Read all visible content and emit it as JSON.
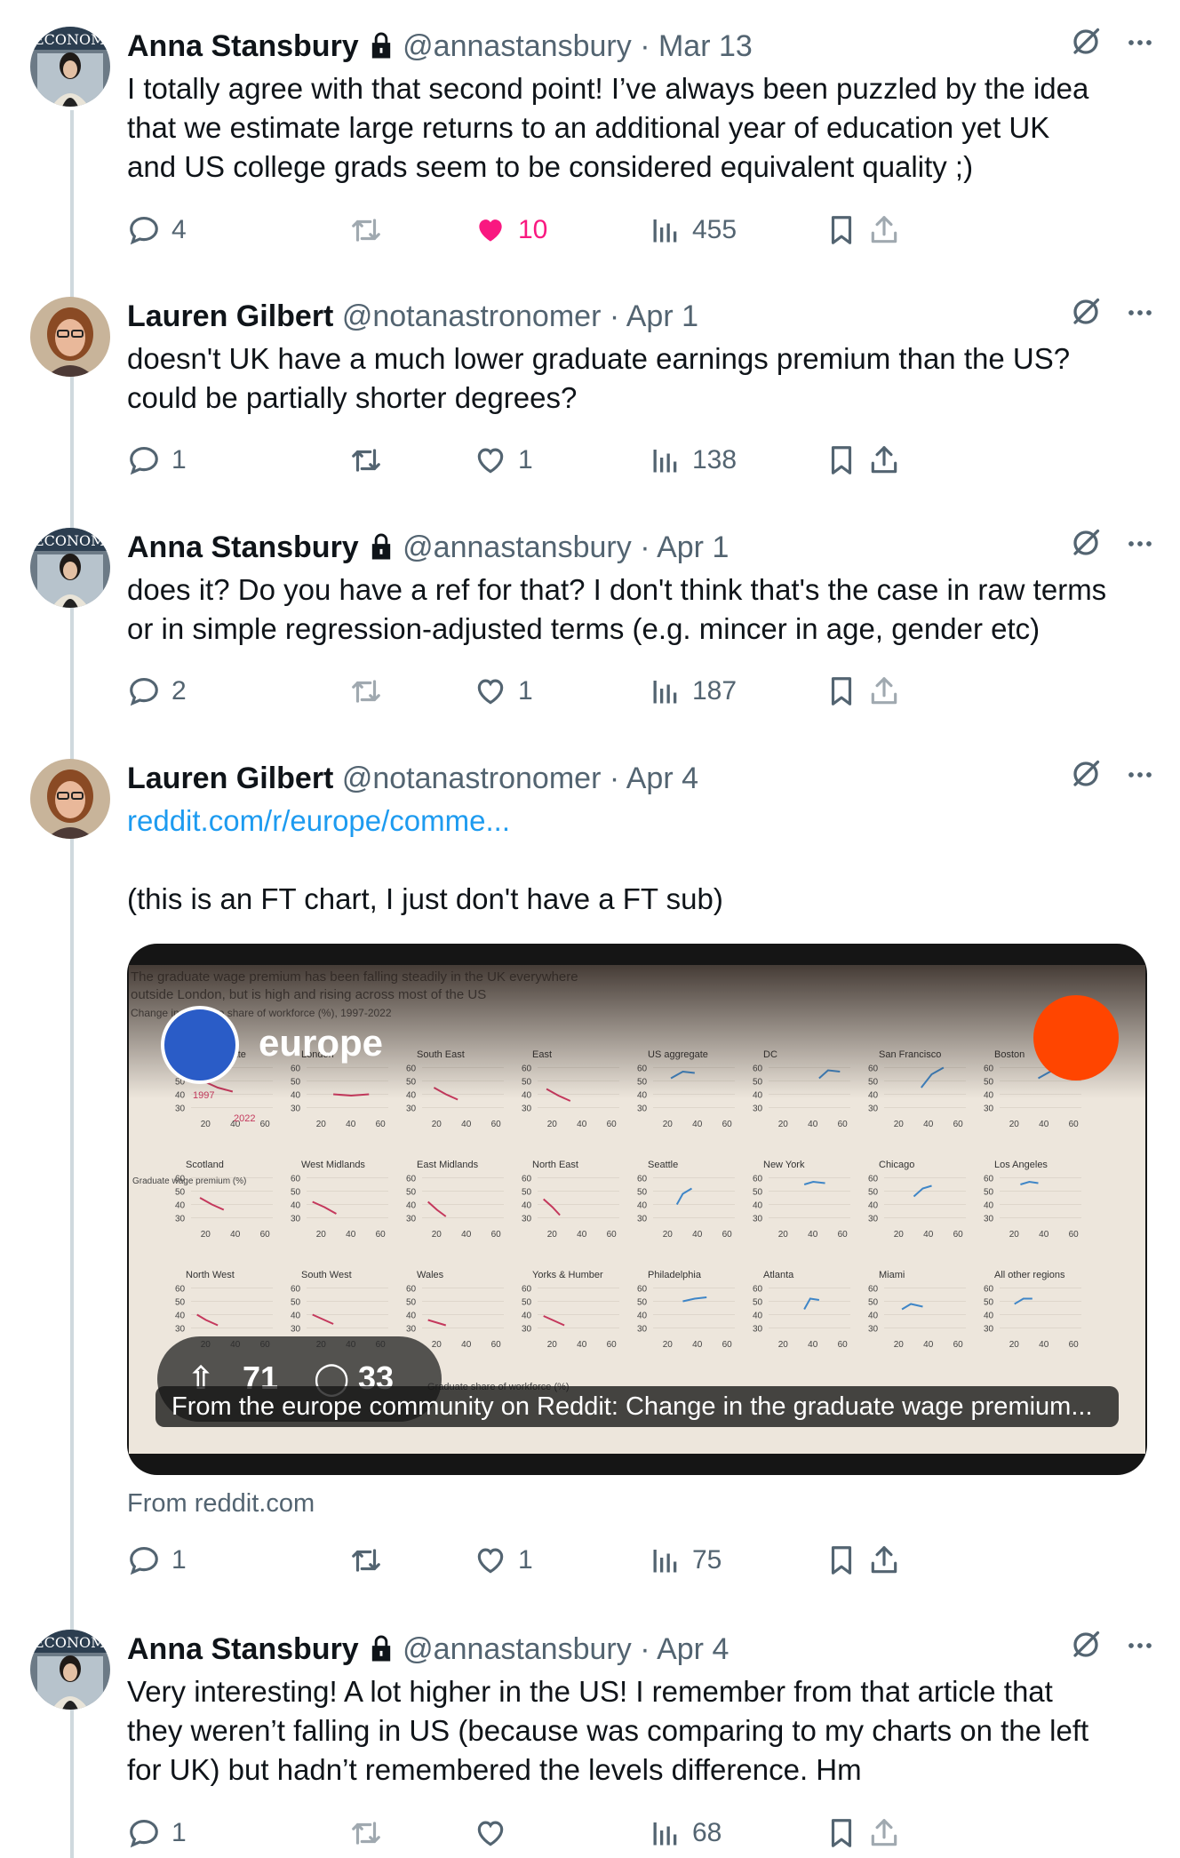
{
  "colors": {
    "text": "#0f1419",
    "muted": "#536471",
    "link": "#1d9bf0",
    "like": "#f91880",
    "thread": "#cfd9de"
  },
  "tweets": [
    {
      "name": "Anna Stansbury",
      "locked": true,
      "handle": "@annastansbury",
      "sep": "·",
      "date": "Mar 13",
      "lines": [
        "I totally agree with that second point! I’ve always been puzzled by the idea",
        "that we estimate large returns to an additional year of education yet UK",
        "and US college grads seem to be considered equivalent quality ;)"
      ],
      "actions": {
        "replies": "4",
        "retweets": "",
        "likes": "10",
        "liked": true,
        "views": "455"
      }
    },
    {
      "name": "Lauren Gilbert",
      "locked": false,
      "handle": "@notanastronomer",
      "sep": "·",
      "date": "Apr 1",
      "lines": [
        "doesn't UK have a much lower graduate earnings premium than the US?",
        "could be partially shorter degrees?"
      ],
      "actions": {
        "replies": "1",
        "retweets": "",
        "likes": "1",
        "liked": false,
        "views": "138"
      }
    },
    {
      "name": "Anna Stansbury",
      "locked": true,
      "handle": "@annastansbury",
      "sep": "·",
      "date": "Apr 1",
      "lines": [
        "does it? Do you have a ref for that? I don't think that's the case in raw terms",
        "or in simple regression-adjusted terms (e.g. mincer in age, gender etc)"
      ],
      "actions": {
        "replies": "2",
        "retweets": "",
        "likes": "1",
        "liked": false,
        "views": "187"
      }
    },
    {
      "name": "Lauren Gilbert",
      "locked": false,
      "handle": "@notanastronomer",
      "sep": "·",
      "date": "Apr 4",
      "link": "reddit.com/r/europe/comme...",
      "lines": [
        "(this is an FT chart, I just don't have a FT sub)"
      ],
      "card": {
        "subreddit": "europe",
        "chart_heading_1": "The graduate wage premium has been falling steadily in the UK everywhere",
        "chart_heading_2": "outside London, but is high and rising across most of the US",
        "chart_heading_3": "Change in graduate share of workforce (%), 1997-2022",
        "caption": "From the europe community on Reddit: Change in the graduate wage premium...",
        "upvotes": "71",
        "comments": "33",
        "domain": "From reddit.com"
      },
      "actions": {
        "replies": "1",
        "retweets": "",
        "likes": "1",
        "liked": false,
        "views": "75"
      }
    },
    {
      "name": "Anna Stansbury",
      "locked": true,
      "handle": "@annastansbury",
      "sep": "·",
      "date": "Apr 4",
      "lines": [
        "Very interesting! A lot higher in the US! I remember from that article that",
        "they weren’t falling in US (because was comparing to my charts on the left",
        "for UK) but hadn’t remembered the levels difference. Hm"
      ],
      "actions": {
        "replies": "1",
        "retweets": "",
        "likes": "",
        "liked": false,
        "views": "68"
      }
    }
  ],
  "chart_data": {
    "type": "line",
    "title": "The graduate wage premium has been falling steadily in the UK everywhere outside London, but is high and rising across most of the US",
    "xlabel": "Graduate share of workforce (%)",
    "ylabel": "Graduate wage premium (%)",
    "xlim": [
      10,
      65
    ],
    "ylim": [
      25,
      65
    ],
    "xticks": [
      20,
      40,
      60
    ],
    "yticks": [
      30,
      40,
      50,
      60
    ],
    "annotations": [
      "1997",
      "2022"
    ],
    "panels": [
      {
        "name": "UK aggregate",
        "x": [
          18,
          28,
          38
        ],
        "y": [
          50,
          45,
          42
        ]
      },
      {
        "name": "London",
        "x": [
          28,
          40,
          52
        ],
        "y": [
          40,
          39,
          40
        ]
      },
      {
        "name": "South East",
        "x": [
          18,
          26,
          34
        ],
        "y": [
          45,
          40,
          36
        ]
      },
      {
        "name": "East",
        "x": [
          16,
          24,
          32
        ],
        "y": [
          44,
          39,
          35
        ]
      },
      {
        "name": "US aggregate",
        "x": [
          22,
          30,
          38
        ],
        "y": [
          52,
          57,
          56
        ]
      },
      {
        "name": "DC",
        "x": [
          44,
          50,
          58
        ],
        "y": [
          52,
          58,
          57
        ]
      },
      {
        "name": "San Francisco",
        "x": [
          35,
          42,
          50
        ],
        "y": [
          45,
          55,
          60
        ]
      },
      {
        "name": "Boston",
        "x": [
          36,
          44,
          54
        ],
        "y": [
          52,
          57,
          58
        ]
      },
      {
        "name": "Scotland",
        "x": [
          16,
          24,
          32
        ],
        "y": [
          45,
          40,
          36
        ]
      },
      {
        "name": "West Midlands",
        "x": [
          14,
          22,
          30
        ],
        "y": [
          42,
          38,
          33
        ]
      },
      {
        "name": "East Midlands",
        "x": [
          14,
          20,
          26
        ],
        "y": [
          42,
          36,
          31
        ]
      },
      {
        "name": "North East",
        "x": [
          14,
          20,
          25
        ],
        "y": [
          44,
          38,
          32
        ]
      },
      {
        "name": "Seattle",
        "x": [
          26,
          30,
          36
        ],
        "y": [
          40,
          48,
          52
        ]
      },
      {
        "name": "New York",
        "x": [
          34,
          40,
          48
        ],
        "y": [
          55,
          57,
          56
        ]
      },
      {
        "name": "Chicago",
        "x": [
          30,
          36,
          42
        ],
        "y": [
          46,
          52,
          54
        ]
      },
      {
        "name": "Los Angeles",
        "x": [
          24,
          30,
          36
        ],
        "y": [
          55,
          57,
          56
        ]
      },
      {
        "name": "North West",
        "x": [
          14,
          20,
          28
        ],
        "y": [
          40,
          36,
          32
        ]
      },
      {
        "name": "South West",
        "x": [
          14,
          20,
          28
        ],
        "y": [
          40,
          37,
          33
        ]
      },
      {
        "name": "Wales",
        "x": [
          14,
          20,
          26
        ],
        "y": [
          36,
          34,
          32
        ]
      },
      {
        "name": "Yorks & Humber",
        "x": [
          14,
          20,
          28
        ],
        "y": [
          39,
          36,
          32
        ]
      },
      {
        "name": "Philadelphia",
        "x": [
          30,
          38,
          46
        ],
        "y": [
          50,
          52,
          53
        ]
      },
      {
        "name": "Atlanta",
        "x": [
          34,
          38,
          44
        ],
        "y": [
          44,
          52,
          51
        ]
      },
      {
        "name": "Miami",
        "x": [
          22,
          28,
          36
        ],
        "y": [
          44,
          48,
          46
        ]
      },
      {
        "name": "All other regions",
        "x": [
          20,
          26,
          32
        ],
        "y": [
          48,
          52,
          52
        ]
      }
    ]
  }
}
